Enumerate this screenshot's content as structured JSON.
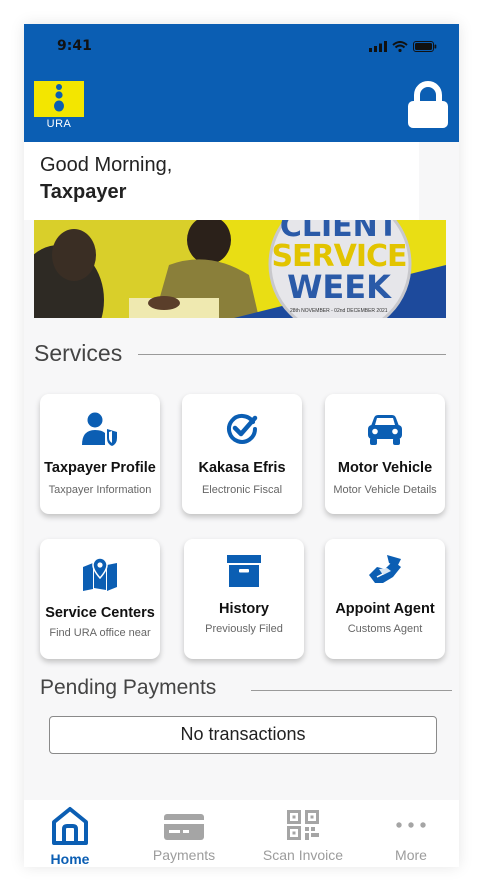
{
  "status_bar": {
    "time": "9:41"
  },
  "header": {
    "logo_text": "URA",
    "lock_icon": "lock-icon"
  },
  "greeting": {
    "line1": "Good Morning,",
    "line2": "Taxpayer"
  },
  "banner": {
    "line1": "CLIENT",
    "line2": "SERVICE",
    "line3": "WEEK",
    "date_text": "28th NOVEMBER - 02nd DECEMBER 2021"
  },
  "services": {
    "title": "Services",
    "items": [
      {
        "label": "Taxpayer Profile",
        "sub": "Taxpayer Information",
        "icon": "user-shield-icon"
      },
      {
        "label": "Kakasa Efris",
        "sub": "Electronic Fiscal",
        "icon": "check-circle-icon"
      },
      {
        "label": "Motor Vehicle",
        "sub": "Motor Vehicle Details",
        "icon": "car-icon"
      },
      {
        "label": "Service Centers",
        "sub": "Find URA office near",
        "icon": "map-pin-icon"
      },
      {
        "label": "History",
        "sub": "Previously Filed",
        "icon": "archive-box-icon"
      },
      {
        "label": "Appoint Agent",
        "sub": "Customs Agent",
        "icon": "handshake-icon"
      }
    ]
  },
  "pending": {
    "title": "Pending Payments",
    "empty_text": "No transactions"
  },
  "tabs": [
    {
      "label": "Home",
      "icon": "home-icon",
      "active": true
    },
    {
      "label": "Payments",
      "icon": "credit-card-icon",
      "active": false
    },
    {
      "label": "Scan Invoice",
      "icon": "qr-code-icon",
      "active": false
    },
    {
      "label": "More",
      "icon": "more-dots-icon",
      "active": false
    }
  ],
  "colors": {
    "primary": "#0b5eb3",
    "logo_yellow": "#f3e600",
    "tab_inactive": "#9c9c9c"
  }
}
